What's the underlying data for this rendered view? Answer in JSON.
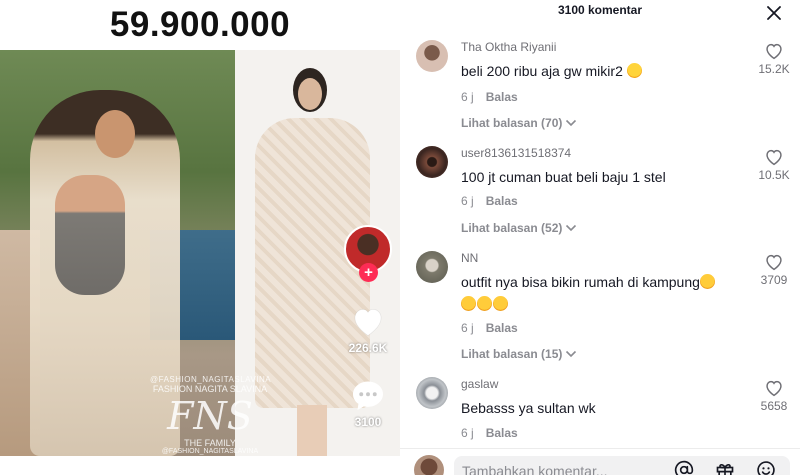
{
  "video": {
    "price_text": "59.900.000",
    "watermark": {
      "handle_top": "@FASHION_NAGITASLAVINA",
      "subtitle": "FASHION NAGITA SLAVINA",
      "logo": "FNS",
      "family": "THE FAMILY",
      "handle_bottom": "@FASHION_NAGITASLAVINA"
    },
    "actions": {
      "likes": "226.6K",
      "comments": "3100"
    }
  },
  "panel": {
    "title": "3100 komentar",
    "comments": [
      {
        "user": "Tha Oktha Riyanii",
        "text": "beli 200 ribu aja gw mikir2 ",
        "emojis": [
          "laugh"
        ],
        "time": "6 j",
        "reply_label": "Balas",
        "more_label": "Lihat balasan (70)",
        "likes": "15.2K",
        "avatar_color": "#c9a89a"
      },
      {
        "user": "user8136131518374",
        "text": "100 jt cuman buat beli baju 1 stel",
        "emojis": [],
        "time": "6 j",
        "reply_label": "Balas",
        "more_label": "Lihat balasan (52)",
        "likes": "10.5K",
        "avatar_color": "#5a3a30"
      },
      {
        "user": "NN",
        "text": "outfit nya bisa bikin rumah di kampung",
        "emojis_line2": [
          "cry",
          "cry",
          "cry"
        ],
        "time": "6 j",
        "reply_label": "Balas",
        "more_label": "Lihat balasan (15)",
        "likes": "3709",
        "avatar_color": "#8a8a7e"
      },
      {
        "user": "gaslaw",
        "text": "Bebasss ya sultan wk",
        "emojis": [],
        "time": "6 j",
        "reply_label": "Balas",
        "likes": "5658",
        "avatar_color": "#9ea3a8"
      }
    ],
    "input": {
      "placeholder": "Tambahkan komentar..."
    }
  },
  "colors": {
    "accent": "#fe2c55",
    "text": "#161823",
    "muted": "#8a8b91"
  }
}
